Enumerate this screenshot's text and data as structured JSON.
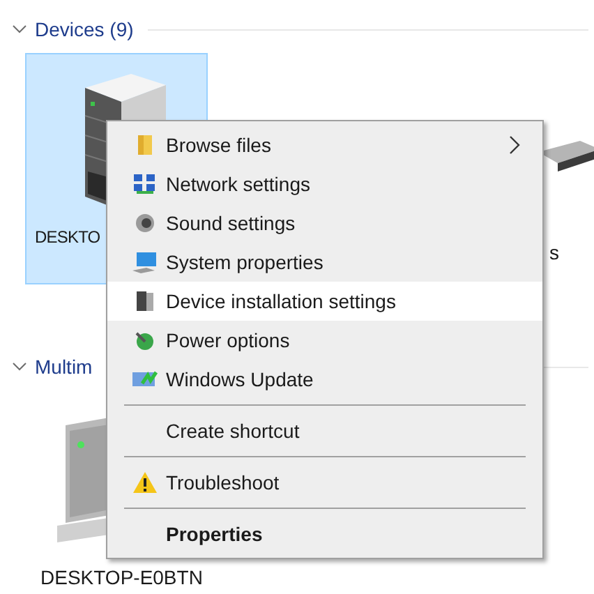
{
  "groups": [
    {
      "header": "Devices (9)",
      "expanded": true,
      "devices": [
        {
          "label": "DESKTO",
          "selected": true
        },
        {
          "label": "s",
          "selected": false
        }
      ]
    },
    {
      "header": "Multim",
      "expanded": true,
      "devices": [
        {
          "label": "DESKTOP-E0BTN",
          "selected": false
        }
      ]
    }
  ],
  "context_menu": {
    "sections": [
      [
        {
          "label": "Browse files",
          "has_submenu": true,
          "selected": false,
          "default": false
        },
        {
          "label": "Network settings",
          "has_submenu": false,
          "selected": false,
          "default": false
        },
        {
          "label": "Sound settings",
          "has_submenu": false,
          "selected": false,
          "default": false
        },
        {
          "label": "System properties",
          "has_submenu": false,
          "selected": false,
          "default": false
        },
        {
          "label": "Device installation settings",
          "has_submenu": false,
          "selected": true,
          "default": false
        },
        {
          "label": "Power options",
          "has_submenu": false,
          "selected": false,
          "default": false
        },
        {
          "label": "Windows Update",
          "has_submenu": false,
          "selected": false,
          "default": false
        }
      ],
      [
        {
          "label": "Create shortcut",
          "has_submenu": false,
          "selected": false,
          "default": false
        }
      ],
      [
        {
          "label": "Troubleshoot",
          "has_submenu": false,
          "selected": false,
          "default": false
        }
      ],
      [
        {
          "label": "Properties",
          "has_submenu": false,
          "selected": false,
          "default": true
        }
      ]
    ]
  }
}
